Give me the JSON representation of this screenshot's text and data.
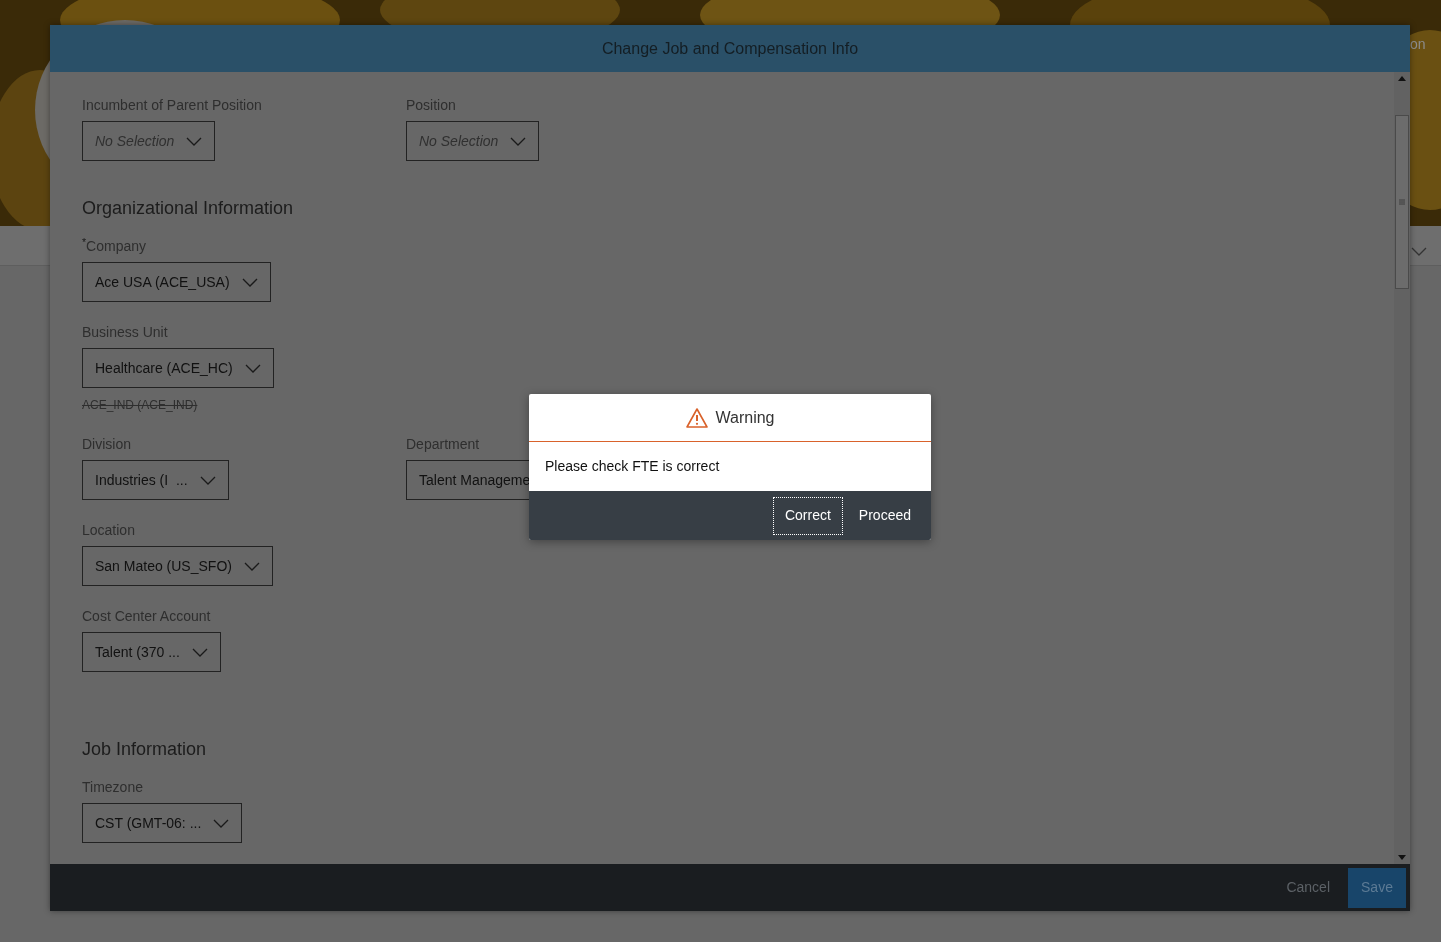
{
  "background": {
    "header_text": "on"
  },
  "modal": {
    "title": "Change Job and Compensation Info",
    "sections": [
      {
        "rows": [
          [
            {
              "label": "Incumbent of Parent Position",
              "placeholder": "No Selection"
            },
            {
              "label": "Position",
              "placeholder": "No Selection"
            }
          ]
        ]
      },
      {
        "title": "Organizational Information",
        "rows": [
          [
            {
              "label": "Company",
              "required_mark": "*",
              "value": "Ace USA (ACE_USA)"
            }
          ],
          [
            {
              "label": "Business Unit",
              "value": "Healthcare (ACE_HC)",
              "previous": "ACE_IND (ACE_IND)"
            }
          ],
          [
            {
              "label": "Division",
              "value": "Industries (I  ..."
            },
            {
              "label": "Department",
              "value": "Talent Manageme"
            }
          ],
          [
            {
              "label": "Location",
              "value": "San Mateo (US_SFO)"
            }
          ],
          [
            {
              "label": "Cost Center Account",
              "value": "Talent (370 ..."
            }
          ]
        ]
      },
      {
        "title": "Job Information",
        "rows": [
          [
            {
              "label": "Timezone",
              "value": "CST (GMT-06: ..."
            }
          ]
        ]
      }
    ],
    "footer": {
      "cancel": "Cancel",
      "save": "Save"
    }
  },
  "dialog": {
    "title": "Warning",
    "message": "Please check FTE is correct",
    "buttons": [
      {
        "label": "Correct",
        "focused": true
      },
      {
        "label": "Proceed",
        "focused": false
      }
    ]
  }
}
